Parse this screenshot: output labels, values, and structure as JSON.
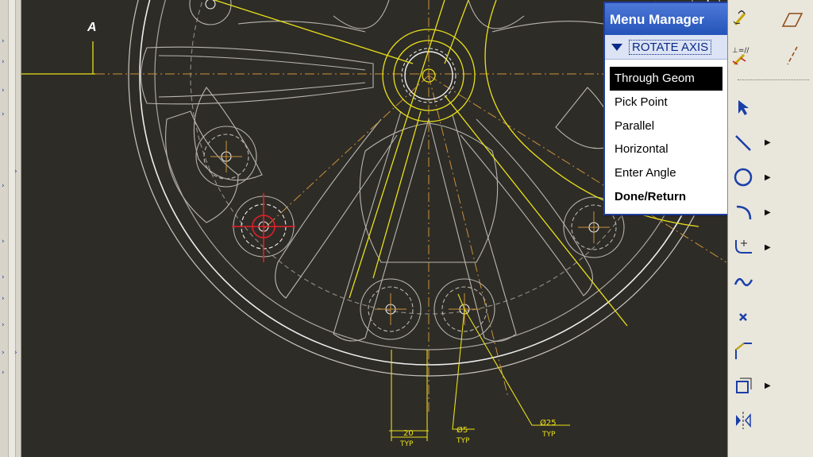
{
  "drawing": {
    "section_label": "A",
    "dim_width": "20",
    "dim_width_typ": "TYP",
    "dim_dia_small": "Ø5",
    "dim_dia_small_typ": "TYP",
    "dim_dia_large": "Ø25",
    "dim_dia_large_typ": "TYP"
  },
  "menu_manager": {
    "title": "Menu Manager",
    "submenu": "ROTATE AXIS",
    "items": [
      {
        "label": "Through Geom",
        "selected": true
      },
      {
        "label": "Pick Point"
      },
      {
        "label": "Parallel"
      },
      {
        "label": "Horizontal"
      },
      {
        "label": "Enter Angle"
      },
      {
        "label": "Done/Return",
        "bold": true
      }
    ]
  },
  "toolbar": {
    "icons": [
      "dimension-icon",
      "parallelogram-icon",
      "text-format-icon",
      "dash-line-icon",
      "select-arrow-icon",
      "line-icon",
      "circle-icon",
      "arc-icon",
      "fillet-icon",
      "spline-icon",
      "point-icon",
      "chamfer-icon",
      "offset-icon",
      "mirror-icon"
    ]
  },
  "colors": {
    "background": "#2e2c27",
    "geometry": "#c8c6be",
    "highlight": "#e8e01a",
    "centerline": "#c9923a",
    "cursor": "#e0202a",
    "menu_title": "#2454b8"
  }
}
